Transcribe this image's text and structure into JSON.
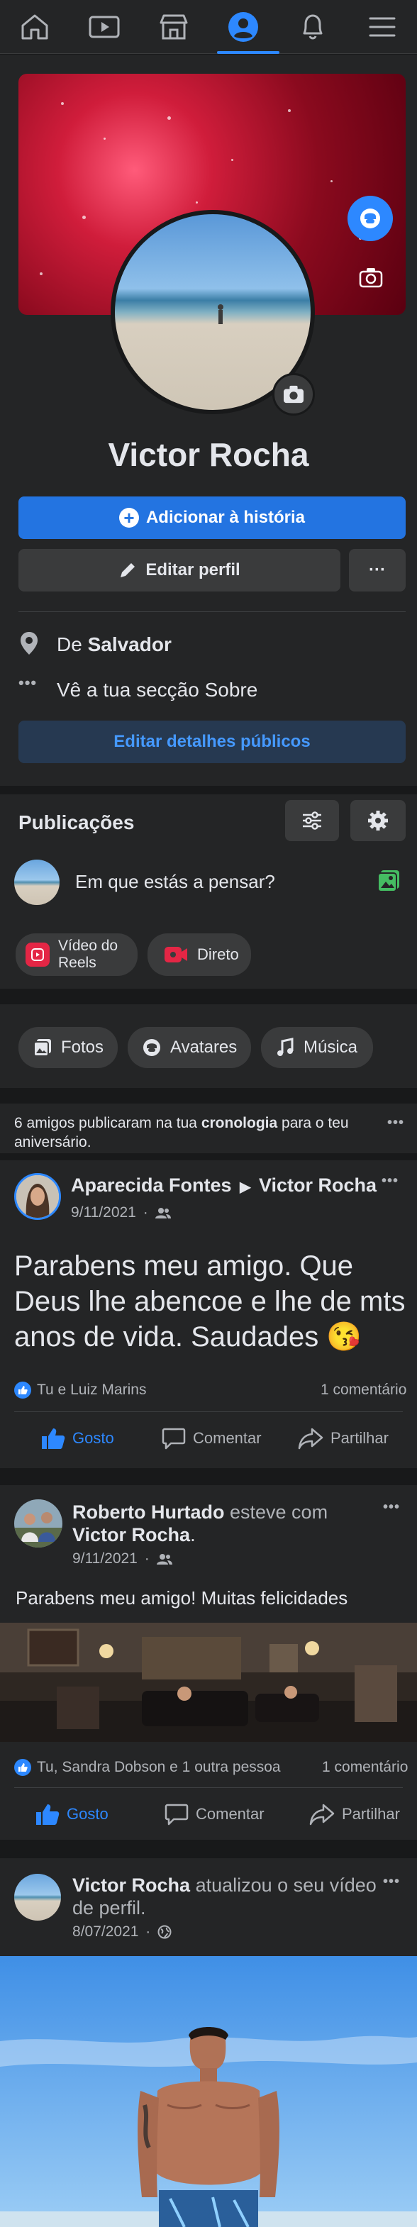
{
  "nav": {
    "items": [
      "home-icon",
      "watch-icon",
      "marketplace-icon",
      "profile-icon",
      "notifications-icon",
      "menu-icon"
    ],
    "active": "profile-icon",
    "accent": "#2d88ff"
  },
  "profile": {
    "name": "Victor Rocha",
    "add_story_label": "Adicionar à história",
    "edit_profile_label": "Editar perfil",
    "more_label": "···",
    "from_prefix": "De",
    "from_city": "Salvador",
    "about_label": "Vê a tua secção Sobre",
    "edit_public_label": "Editar detalhes públicos"
  },
  "composer": {
    "section_title": "Publicações",
    "placeholder": "Em que estás a pensar?",
    "reels_label_line1": "Vídeo do",
    "reels_label_line2": "Reels",
    "live_label": "Direto"
  },
  "filters": {
    "photos": "Fotos",
    "avatars": "Avatares",
    "music": "Música"
  },
  "birthday_banner": {
    "text_before": "6 amigos publicaram na tua",
    "text_bold": "cronologia",
    "text_after": "para o teu",
    "text_line2": "aniversário."
  },
  "posts": [
    {
      "author": "Aparecida Fontes",
      "arrow": "▶",
      "target": "Victor Rocha",
      "date": "9/11/2021",
      "body_line1": "Parabens meu amigo. Que",
      "body_line2": "Deus lhe abencoe e lhe de mts",
      "body_line3": "anos de vida. Saudades 😘",
      "reactions": "Tu e Luiz Marins",
      "comments": "1 comentário",
      "like": "Gosto",
      "comment": "Comentar",
      "share": "Partilhar"
    },
    {
      "author": "Roberto Hurtado",
      "with_text": "esteve com",
      "target": "Victor Rocha",
      "target_suffix": ".",
      "date": "9/11/2021",
      "body": "Parabens meu amigo! Muitas felicidades",
      "reactions": "Tu, Sandra Dobson e 1 outra pessoa",
      "comments": "1 comentário",
      "like": "Gosto",
      "comment": "Comentar",
      "share": "Partilhar"
    },
    {
      "author": "Victor Rocha",
      "action_line1": "atualizou o seu vídeo",
      "action_line2": "de perfil.",
      "date": "8/07/2021"
    }
  ],
  "colors": {
    "background": "#18191a",
    "card": "#242526",
    "primary": "#2d88ff",
    "primary_button": "#2374e1",
    "secondary_button": "#3a3b3c",
    "soft_blue_button": "#263951",
    "reels_red": "#e42645",
    "text": "#e4e6eb",
    "muted": "#b0b3b8"
  }
}
